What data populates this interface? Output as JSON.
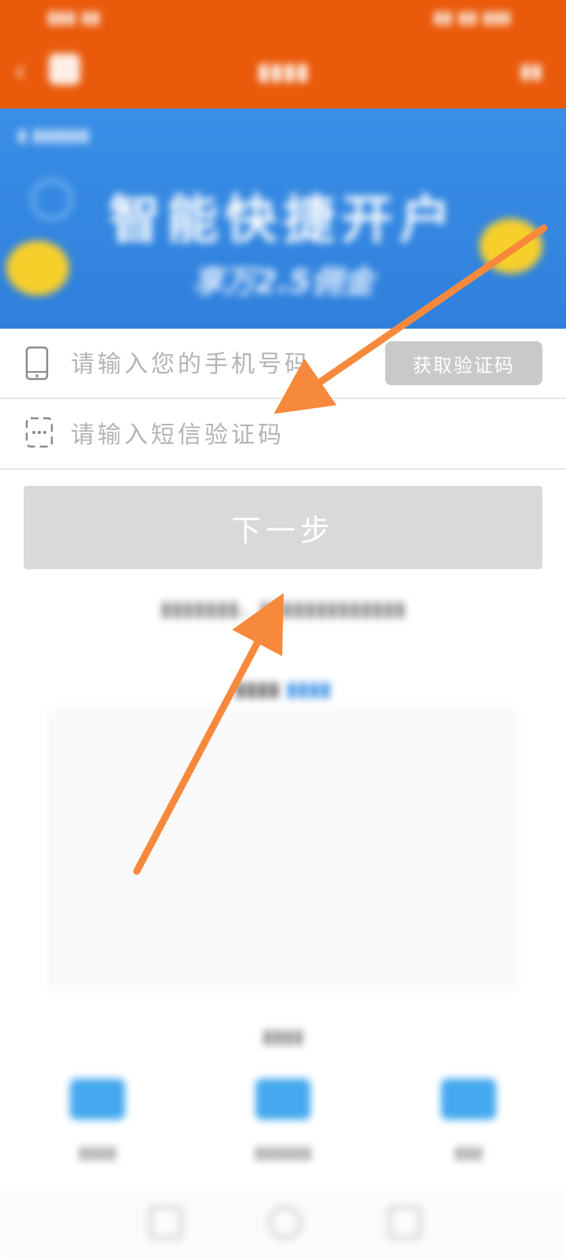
{
  "form": {
    "phone_placeholder": "请输入您的手机号码",
    "phone_value": "",
    "sms_placeholder": "请输入短信验证码",
    "sms_value": "",
    "get_code_label": "获取验证码",
    "next_label": "下一步"
  },
  "banner": {
    "headline": "智能快捷开户",
    "subline": "享万2.5佣金"
  },
  "icons": {
    "phone": "mobile-phone-icon",
    "sms": "message-code-icon"
  },
  "colors": {
    "topbar": "#ea5a0b",
    "banner": "#2f80dc",
    "arrow": "#f7893c",
    "button_disabled": "#d9d9d9"
  }
}
